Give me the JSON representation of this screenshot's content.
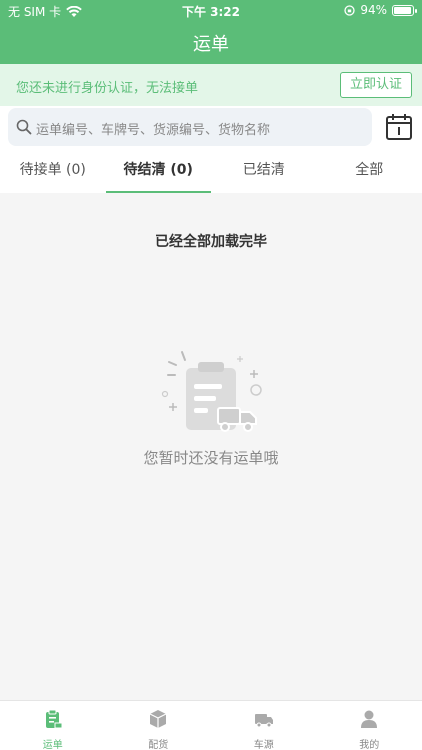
{
  "status_bar": {
    "carrier": "无 SIM 卡",
    "time": "下午 3:22",
    "battery": "94%"
  },
  "nav": {
    "title": "运单"
  },
  "auth_banner": {
    "message": "您还未进行身份认证，无法接单",
    "button_label": "立即认证"
  },
  "search": {
    "placeholder": "运单编号、车牌号、货源编号、货物名称"
  },
  "tabs": [
    {
      "label": "待接单 (0)",
      "active": false
    },
    {
      "label": "待结清 (0)",
      "active": true
    },
    {
      "label": "已结清",
      "active": false
    },
    {
      "label": "全部",
      "active": false
    }
  ],
  "content": {
    "loaded_message": "已经全部加载完毕",
    "empty_message": "您暂时还没有运单哦"
  },
  "tabbar": [
    {
      "label": "运单",
      "icon": "waybill-icon",
      "active": true
    },
    {
      "label": "配货",
      "icon": "box-icon",
      "active": false
    },
    {
      "label": "车源",
      "icon": "truck-icon",
      "active": false
    },
    {
      "label": "我的",
      "icon": "user-icon",
      "active": false
    }
  ],
  "colors": {
    "primary": "#5bbd78",
    "banner_bg": "#e3f6e8",
    "search_bg": "#eef2f6"
  }
}
